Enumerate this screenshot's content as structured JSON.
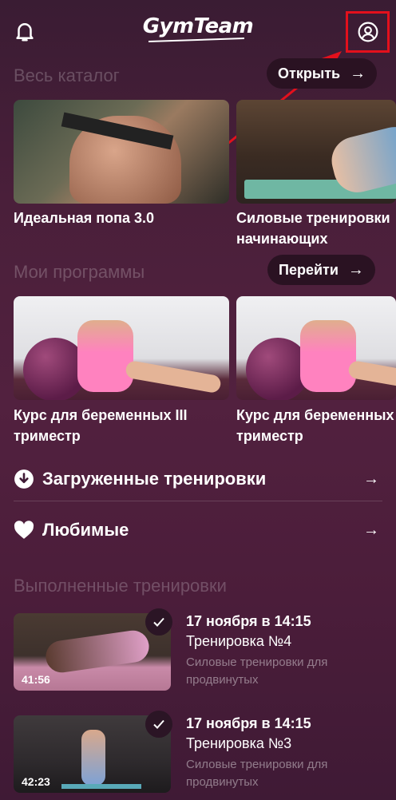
{
  "header": {
    "logo_text": "GymTeam",
    "icons": {
      "left": "bell-icon",
      "right": "profile-icon"
    },
    "annotation_color": "#e3101c"
  },
  "catalog": {
    "title": "Весь каталог",
    "button_label": "Открыть",
    "cards": [
      {
        "title_lines": [
          "Идеальная попа 3.0"
        ]
      },
      {
        "title_lines": [
          "Силовые тренировки",
          "начинающих"
        ]
      }
    ]
  },
  "my_programs": {
    "title": "Мои программы",
    "button_label": "Перейти",
    "cards": [
      {
        "title_lines": [
          "Курс для беременных III",
          "триместр"
        ]
      },
      {
        "title_lines": [
          "Курс для беременных",
          "триместр"
        ]
      }
    ]
  },
  "links": {
    "downloaded": {
      "label": "Загруженные тренировки",
      "icon": "download-icon"
    },
    "favorites": {
      "label": "Любимые",
      "icon": "heart-icon"
    }
  },
  "completed": {
    "title": "Выполненные тренировки",
    "items": [
      {
        "date": "17 ноября в 14:15",
        "name": "Тренировка №4",
        "program": "Силовые тренировки для продвинутых",
        "duration": "41:56"
      },
      {
        "date": "17 ноября в 14:15",
        "name": "Тренировка №3",
        "program": "Силовые тренировки для продвинутых",
        "duration": "42:23"
      }
    ]
  }
}
